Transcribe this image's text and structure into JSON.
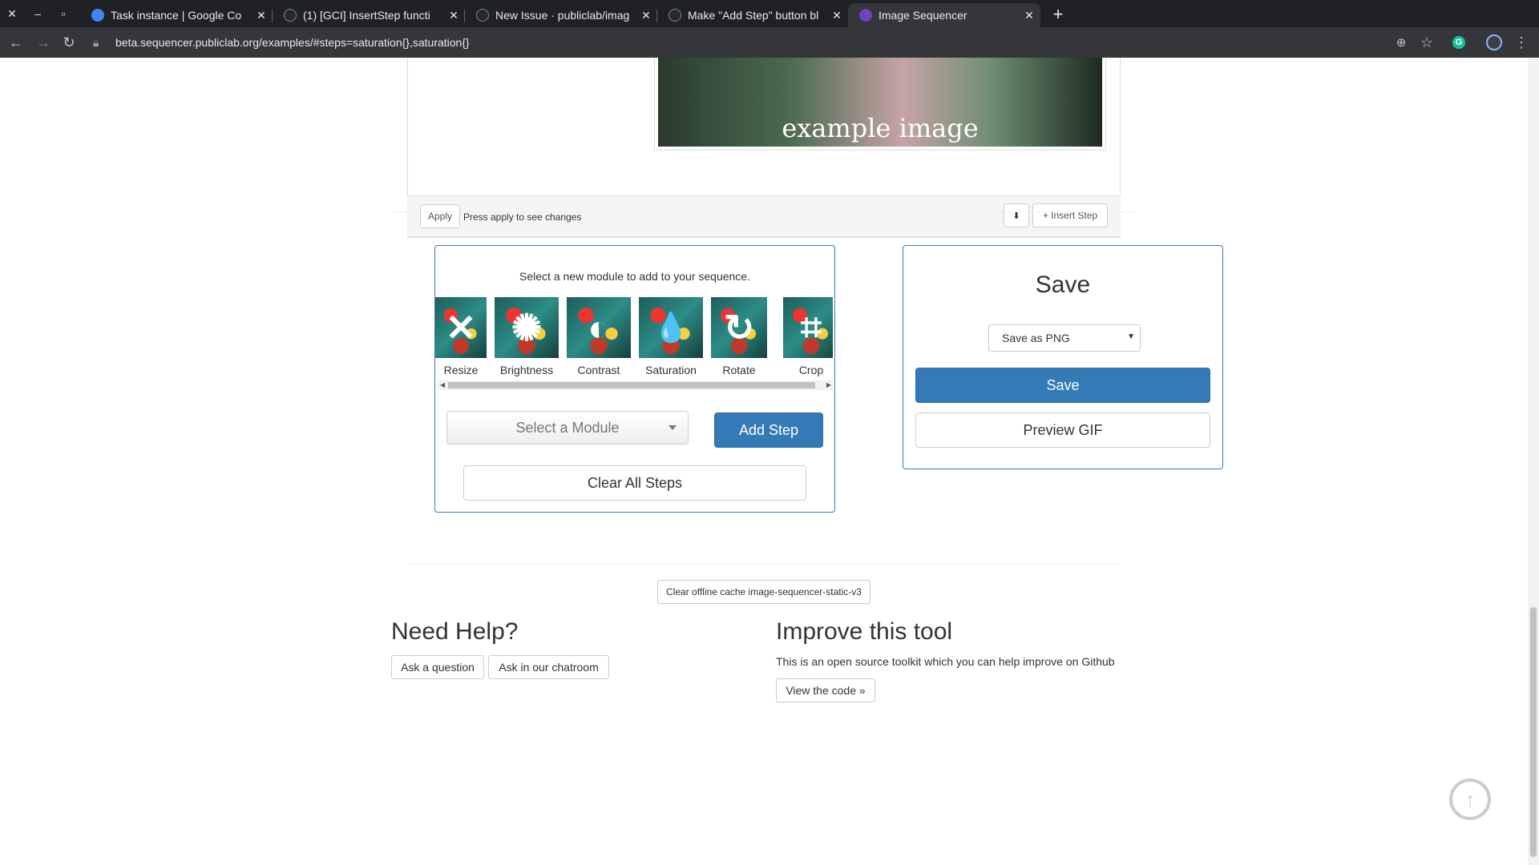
{
  "browser": {
    "window_controls": [
      "✕",
      "–",
      "▫"
    ],
    "tabs": [
      {
        "label": "Task instance | Google Co",
        "close": "✕"
      },
      {
        "label": "(1) [GCI] InsertStep functi",
        "close": "✕"
      },
      {
        "label": "New Issue · publiclab/imag",
        "close": "✕"
      },
      {
        "label": "Make \"Add Step\" button bl",
        "close": "✕"
      },
      {
        "label": "Image Sequencer",
        "close": "✕"
      }
    ],
    "new_tab": "+",
    "url": "beta.sequencer.publiclab.org/examples/#steps=saturation{},saturation{}"
  },
  "step": {
    "image_caption": "example image",
    "apply_label": "Apply",
    "apply_hint": "Press apply to see changes",
    "download_icon": "download-icon",
    "insert_step_label": "+ Insert Step"
  },
  "add_module": {
    "title": "Select a new module to add to your sequence.",
    "modules": [
      {
        "label": "Resize",
        "icon": "resize-icon",
        "glyph": "✕"
      },
      {
        "label": "Brightness",
        "icon": "brightness-icon",
        "glyph": "✺"
      },
      {
        "label": "Contrast",
        "icon": "contrast-icon",
        "glyph": "◐"
      },
      {
        "label": "Saturation",
        "icon": "saturation-icon",
        "glyph": "💧"
      },
      {
        "label": "Rotate",
        "icon": "rotate-icon",
        "glyph": "↻"
      },
      {
        "label": "Crop",
        "icon": "crop-icon",
        "glyph": "⌗"
      }
    ],
    "select_placeholder": "Select a Module",
    "add_step_label": "Add Step",
    "clear_all_label": "Clear All Steps"
  },
  "save_panel": {
    "title": "Save",
    "format_selected": "Save as PNG",
    "save_label": "Save",
    "preview_gif_label": "Preview GIF"
  },
  "footer": {
    "clear_cache_label": "Clear offline cache image-sequencer-static-v3",
    "help_title": "Need Help?",
    "ask_question_label": "Ask a question",
    "ask_chatroom_label": "Ask in our chatroom",
    "improve_title": "Improve this tool",
    "improve_text": "This is an open source toolkit which you can help improve on Github",
    "view_code_label": "View the code »"
  },
  "colors": {
    "primary": "#337ab7",
    "chrome_dark": "#202124",
    "chrome_toolbar": "#35363a"
  }
}
